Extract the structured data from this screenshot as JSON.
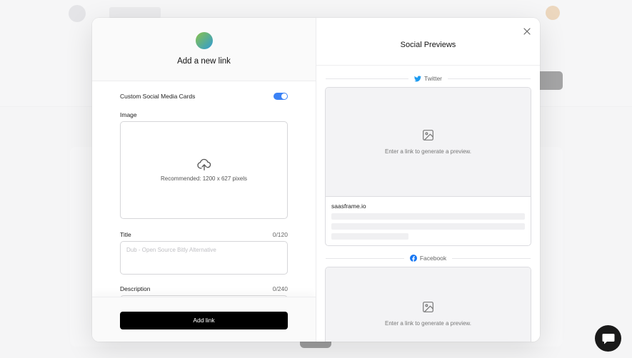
{
  "modal": {
    "left_title": "Add a new link",
    "custom_cards_label": "Custom Social Media Cards",
    "custom_cards_enabled": true,
    "image_label": "Image",
    "image_hint": "Recommended: 1200 x 627 pixels",
    "title_label": "Title",
    "title_count": "0/120",
    "title_placeholder": "Dub - Open Source Bitly Alternative",
    "description_label": "Description",
    "description_count": "0/240",
    "add_button": "Add link"
  },
  "previews": {
    "title": "Social Previews",
    "twitter_label": "Twitter",
    "twitter_placeholder": "Enter a link to generate a preview.",
    "twitter_domain": "saasframe.io",
    "facebook_label": "Facebook",
    "facebook_placeholder": "Enter a link to generate a preview."
  },
  "colors": {
    "toggle": "#3b82f6",
    "twitter": "#1d9bf0",
    "facebook": "#1877f2",
    "button": "#000000"
  },
  "icons": [
    "upload-cloud-icon",
    "close-icon",
    "twitter-icon",
    "facebook-icon",
    "image-icon",
    "chat-icon"
  ]
}
